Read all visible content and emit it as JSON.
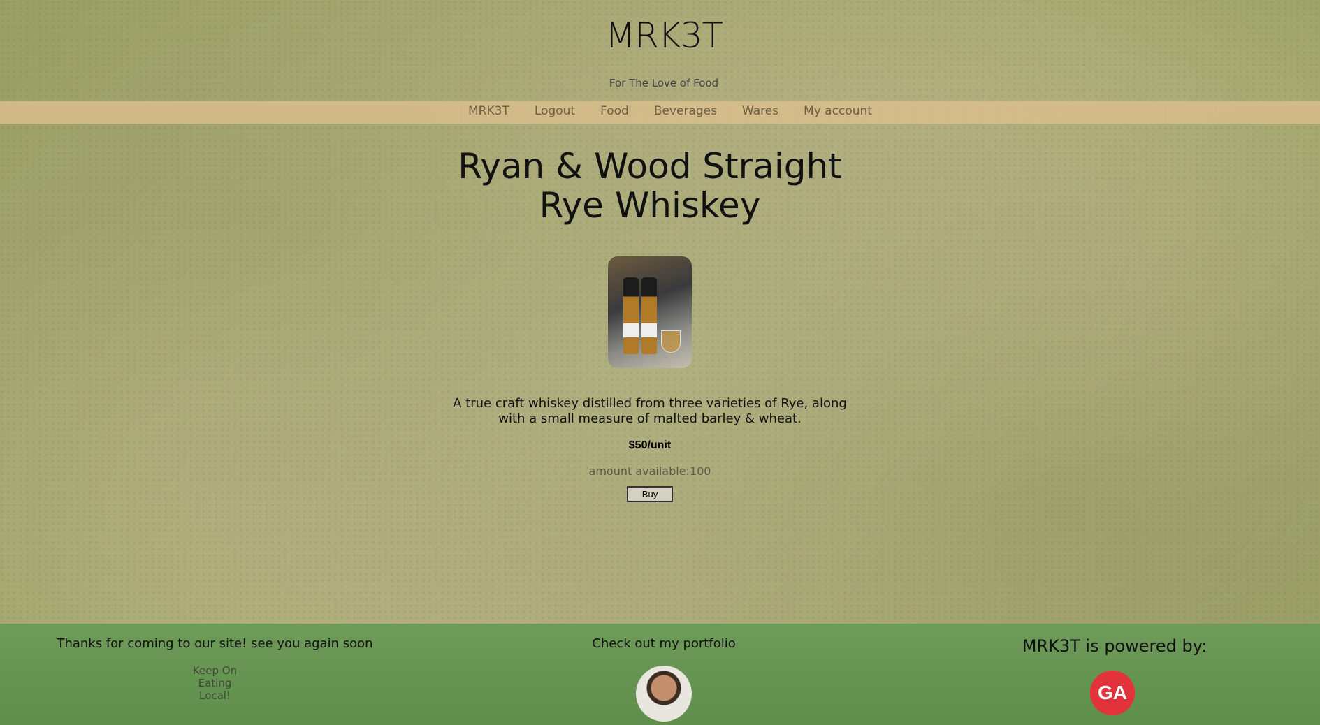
{
  "site": {
    "title": "MRK3T",
    "tagline": "For The Love of Food"
  },
  "nav": {
    "items": [
      "MRK3T",
      "Logout",
      "Food",
      "Beverages",
      "Wares",
      "My account"
    ]
  },
  "product": {
    "title": "Ryan & Wood Straight Rye Whiskey",
    "description": "A true craft whiskey distilled from three varieties of Rye, along with a small measure of malted barley & wheat.",
    "price": "$50/unit",
    "amount_label": "amount available:100",
    "buy_label": "Buy"
  },
  "footer": {
    "thanks": "Thanks for coming to our site! see you again soon",
    "keep_lines": [
      "Keep On",
      "Eating",
      "Local!"
    ],
    "portfolio": "Check out my portfolio",
    "powered": "MRK3T is powered by:",
    "logo_text": "GA"
  },
  "colors": {
    "nav_bar": "#d9bd8c",
    "footer": "#6e9a5a",
    "logo": "#e2323b"
  }
}
